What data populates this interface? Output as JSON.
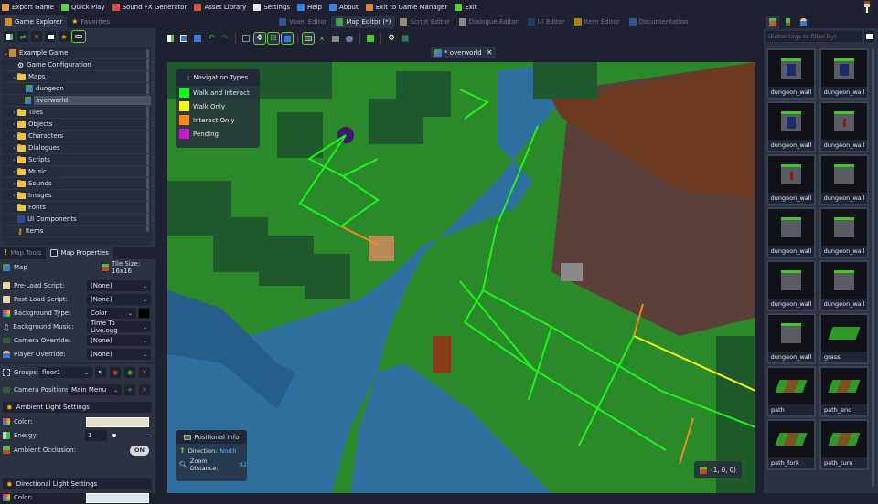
{
  "menubar": {
    "items": [
      {
        "label": "Export Game",
        "icon": "export-icon",
        "color": "#e0a040"
      },
      {
        "label": "Quick Play",
        "icon": "play-icon",
        "color": "#5ed14a"
      },
      {
        "label": "Sound FX Generator",
        "icon": "speaker-icon",
        "color": "#e04a3a"
      },
      {
        "label": "Asset Library",
        "icon": "asset-library-icon",
        "color": "#d05a3a"
      },
      {
        "label": "Settings",
        "icon": "settings-icon",
        "color": "#e3e6ee"
      },
      {
        "label": "Help",
        "icon": "help-icon",
        "color": "#3f7fe0"
      },
      {
        "label": "About",
        "icon": "about-icon",
        "color": "#3f7fe0"
      },
      {
        "label": "Exit to Game Manager",
        "icon": "game-manager-icon",
        "color": "#d08a3a"
      },
      {
        "label": "Exit",
        "icon": "exit-icon",
        "color": "#5ed14a"
      }
    ]
  },
  "left_tabs": [
    {
      "label": "Game Explorer",
      "active": true
    },
    {
      "label": "Favorites",
      "active": false
    }
  ],
  "explorer_toolbar": [
    "new-item",
    "refresh",
    "delete",
    "collapse",
    "favorite",
    "link"
  ],
  "tree": [
    {
      "label": "Example Game",
      "level": 0,
      "arrow": "v",
      "icon": "game"
    },
    {
      "label": "Game Configuration",
      "level": 1,
      "arrow": "",
      "icon": "gear"
    },
    {
      "label": "Maps",
      "level": 1,
      "arrow": "v",
      "icon": "folder"
    },
    {
      "label": "dungeon",
      "level": 2,
      "arrow": "",
      "icon": "map"
    },
    {
      "label": "overworld",
      "level": 2,
      "arrow": "",
      "icon": "map",
      "selected": true
    },
    {
      "label": "Tiles",
      "level": 1,
      "arrow": ">",
      "icon": "folder"
    },
    {
      "label": "Objects",
      "level": 1,
      "arrow": ">",
      "icon": "folder"
    },
    {
      "label": "Characters",
      "level": 1,
      "arrow": ">",
      "icon": "folder"
    },
    {
      "label": "Dialogues",
      "level": 1,
      "arrow": ">",
      "icon": "folder"
    },
    {
      "label": "Scripts",
      "level": 1,
      "arrow": ">",
      "icon": "folder"
    },
    {
      "label": "Music",
      "level": 1,
      "arrow": ">",
      "icon": "folder"
    },
    {
      "label": "Sounds",
      "level": 1,
      "arrow": ">",
      "icon": "folder"
    },
    {
      "label": "Images",
      "level": 1,
      "arrow": ">",
      "icon": "folder"
    },
    {
      "label": "Fonts",
      "level": 1,
      "arrow": "",
      "icon": "folder"
    },
    {
      "label": "UI Components",
      "level": 1,
      "arrow": "",
      "icon": "ui"
    },
    {
      "label": "Items",
      "level": 1,
      "arrow": "",
      "icon": "key"
    }
  ],
  "props_tabs": [
    {
      "label": "Map Tools",
      "active": false
    },
    {
      "label": "Map Properties",
      "active": true
    }
  ],
  "props": {
    "header_label": "Map",
    "tile_size_label": "Tile Size: 16x16",
    "pre_load_script": {
      "label": "Pre-Load Script:",
      "value": "(None)"
    },
    "post_load_script": {
      "label": "Post-Load Script:",
      "value": "(None)"
    },
    "background_type": {
      "label": "Background Type:",
      "value": "Color",
      "color": "#000000"
    },
    "background_music": {
      "label": "Background Music:",
      "value": "Time To Live.ogg"
    },
    "camera_override": {
      "label": "Camera Override:",
      "value": "(None)"
    },
    "player_override": {
      "label": "Player Override:",
      "value": "(None)"
    },
    "groups": {
      "label": "Groups:",
      "value": "floor1"
    },
    "camera_positions": {
      "label": "Camera Positions:",
      "value": "Main Menu"
    },
    "ambient_section": "Ambient Light Settings",
    "ambient_color": {
      "label": "Color:",
      "value": "#e6e0c8"
    },
    "energy": {
      "label": "Energy:",
      "value": "1",
      "slider": 0.1
    },
    "ambient_occlusion": {
      "label": "Ambient Occlusion:",
      "value": "ON"
    },
    "directional_section": "Directional Light Settings",
    "directional_color": {
      "label": "Color:",
      "value": "#d8e6f0"
    }
  },
  "editor_tabs": [
    {
      "label": "Voxel Editor",
      "active": false
    },
    {
      "label": "Map Editor (*)",
      "active": true
    },
    {
      "label": "Script Editor",
      "active": false
    },
    {
      "label": "Dialogue Editor",
      "active": false
    },
    {
      "label": "UI Editor",
      "active": false
    },
    {
      "label": "Item Editor",
      "active": false
    },
    {
      "label": "Documentation",
      "active": false
    }
  ],
  "doc_tab": {
    "label": "* overworld"
  },
  "legend": {
    "title": "Navigation Types",
    "items": [
      {
        "label": "Walk and Interact",
        "color": "#1cf51c"
      },
      {
        "label": "Walk Only",
        "color": "#f5f51c"
      },
      {
        "label": "Interact Only",
        "color": "#f58a1c"
      },
      {
        "label": "Pending",
        "color": "#c01cc0"
      }
    ]
  },
  "positional_info": {
    "title": "Positional Info",
    "direction_label": "Direction:",
    "direction_value": "North",
    "zoom_label": "Zoom Distance:",
    "zoom_value": "92"
  },
  "coordinates": "(1, 0, 0)",
  "right_tabs": [
    "tiles-tab",
    "objects-tab",
    "characters-tab"
  ],
  "filter": {
    "placeholder": "(Enter tags to filter by)"
  },
  "tiles": [
    {
      "name": "dungeon_wall",
      "kind": "wall banner"
    },
    {
      "name": "dungeon_wall",
      "kind": "wall banner"
    },
    {
      "name": "dungeon_wall",
      "kind": "wall banner"
    },
    {
      "name": "dungeon_wall",
      "kind": "wall blood"
    },
    {
      "name": "dungeon_wall",
      "kind": "wall blood"
    },
    {
      "name": "dungeon_wall",
      "kind": "wall"
    },
    {
      "name": "dungeon_wall",
      "kind": "wall"
    },
    {
      "name": "dungeon_wall",
      "kind": "wall"
    },
    {
      "name": "dungeon_wall",
      "kind": "wall"
    },
    {
      "name": "dungeon_wall",
      "kind": "wall"
    },
    {
      "name": "dungeon_wall",
      "kind": "wall"
    },
    {
      "name": "grass",
      "kind": "floor"
    },
    {
      "name": "path",
      "kind": "floor path"
    },
    {
      "name": "path_end",
      "kind": "floor path"
    },
    {
      "name": "path_fork",
      "kind": "floor path"
    },
    {
      "name": "path_turn",
      "kind": "floor path"
    }
  ]
}
